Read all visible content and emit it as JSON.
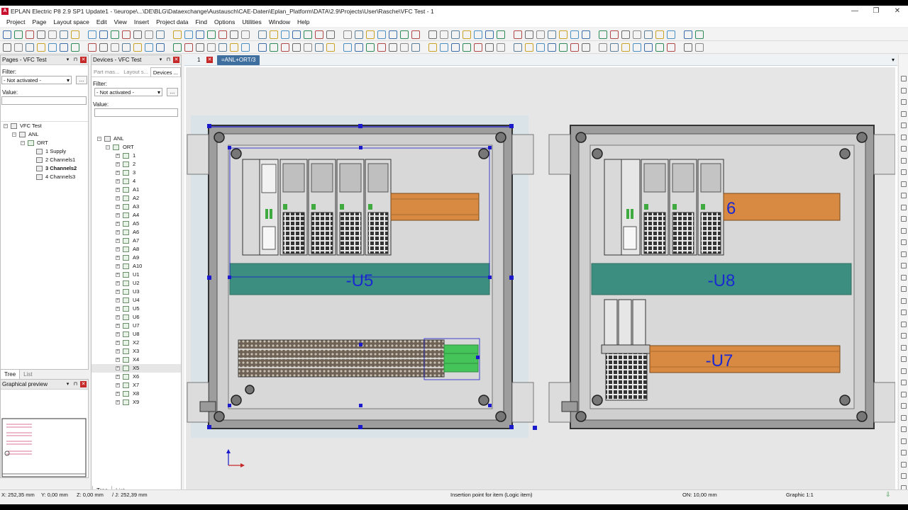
{
  "window": {
    "logo_text": "A",
    "title": "EPLAN Electric P8 2.9 SP1 Update1 - \\\\europe\\...\\DE\\BLG\\Dataexchange\\Austausch\\CAE-Daten\\Eplan_Platform\\DATA\\2.9\\Projects\\User\\Rasche\\VFC Test - 1",
    "controls": {
      "minimize": "—",
      "maximize": "❐",
      "close": "✕"
    }
  },
  "menu": [
    "Project",
    "Page",
    "Layout space",
    "Edit",
    "View",
    "Insert",
    "Project data",
    "Find",
    "Options",
    "Utilities",
    "Window",
    "Help"
  ],
  "pages_panel": {
    "title": "Pages - VFC Test",
    "filter_label": "Filter:",
    "filter_value": "- Not activated -",
    "dots": "...",
    "value_label": "Value:",
    "tree": [
      {
        "label": "VFC Test",
        "level": 0,
        "toggle": "−",
        "icon": "page"
      },
      {
        "label": "ANL",
        "level": 1,
        "toggle": "−",
        "icon": "page"
      },
      {
        "label": "ORT",
        "level": 2,
        "toggle": "−",
        "icon": "folder"
      },
      {
        "label": "1 Supply",
        "level": 3,
        "toggle": "",
        "icon": "page"
      },
      {
        "label": "2 Channels1",
        "level": 3,
        "toggle": "",
        "icon": "page"
      },
      {
        "label": "3 Channels2",
        "level": 3,
        "toggle": "",
        "icon": "page",
        "bold": true
      },
      {
        "label": "4 Channels3",
        "level": 3,
        "toggle": "",
        "icon": "page"
      }
    ],
    "tabs": [
      "Tree",
      "List"
    ],
    "active_tab": "Tree"
  },
  "preview_panel": {
    "title": "Graphical preview"
  },
  "devices_panel": {
    "title": "Devices - VFC Test",
    "subtabs": [
      "Part mas...",
      "Layout s...",
      "Devices ..."
    ],
    "filter_label": "Filter:",
    "filter_value": "- Not activated -",
    "dots": "...",
    "value_label": "Value:",
    "root": "ANL",
    "group": "ORT",
    "items": [
      "1",
      "2",
      "3",
      "4",
      "A1",
      "A2",
      "A3",
      "A4",
      "A5",
      "A6",
      "A7",
      "A8",
      "A9",
      "A10",
      "U1",
      "U2",
      "U3",
      "U4",
      "U5",
      "U6",
      "U7",
      "U8",
      "X2",
      "X3",
      "X4",
      "X5",
      "X6",
      "X7",
      "X8",
      "X9"
    ],
    "selected_item": "X5",
    "tabs": [
      "Tree",
      "List"
    ],
    "active_tab": "Tree"
  },
  "document": {
    "page_number": "1",
    "tab_label": "=ANL+ORT/3"
  },
  "drawing": {
    "labels": {
      "u5": "-U5",
      "u8": "-U8",
      "u7": "-U7",
      "u6_partial": "6"
    },
    "colors": {
      "din_rail": "#d98a42",
      "teal_duct": "#3c8f80",
      "selection": "#1a1acc",
      "label_text": "#1a2ad0",
      "cabinet": "#b9b9b9"
    }
  },
  "status": {
    "x": "X: 252,35 mm",
    "y": "Y: 0,00 mm",
    "z": "Z: 0,00 mm",
    "j": "/ J: 252,39 mm",
    "message": "Insertion point for item (Logic item)",
    "grid": "ON: 10,00 mm",
    "scale": "Graphic 1:1"
  }
}
